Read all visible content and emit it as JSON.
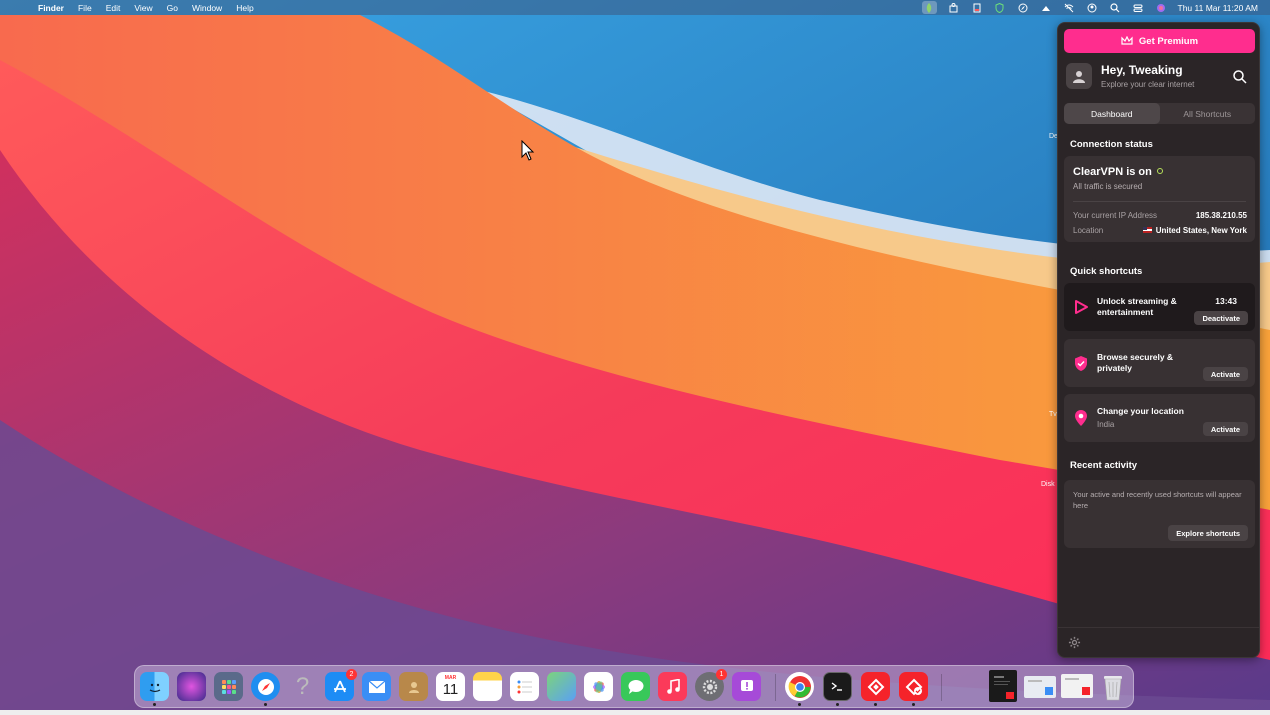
{
  "menubar": {
    "app_name": "Finder",
    "menus": [
      "File",
      "Edit",
      "View",
      "Go",
      "Window",
      "Help"
    ],
    "clock": "Thu 11 Mar  11:20 AM"
  },
  "desktop_labels": [
    "De",
    "Tv",
    "Disk"
  ],
  "vpn": {
    "premium_label": "Get Premium",
    "greeting": "Hey, Tweaking",
    "greeting_sub": "Explore your clear internet",
    "tabs": [
      "Dashboard",
      "All Shortcuts"
    ],
    "connection": {
      "section_title": "Connection status",
      "status": "ClearVPN is on",
      "status_sub": "All traffic is secured",
      "ip_label": "Your current IP Address",
      "ip_value": "185.38.210.55",
      "location_label": "Location",
      "location_value": "United States, New York"
    },
    "quick_shortcuts": {
      "section_title": "Quick shortcuts",
      "items": [
        {
          "title": "Unlock streaming & entertainment",
          "sub": "",
          "time": "13:43",
          "button": "Deactivate"
        },
        {
          "title": "Browse securely & privately",
          "sub": "",
          "time": "",
          "button": "Activate"
        },
        {
          "title": "Change your location",
          "sub": "India",
          "time": "",
          "button": "Activate"
        }
      ]
    },
    "recent": {
      "section_title": "Recent activity",
      "text": "Your active and recently used shortcuts will appear here",
      "button": "Explore shortcuts"
    }
  },
  "dock": {
    "app_store_badge": "2",
    "calendar_month": "MAR",
    "calendar_day": "11",
    "settings_badge": "1"
  },
  "colors": {
    "accent": "#ff2d8e",
    "panel_bg": "#2b2527",
    "card_bg": "#383133",
    "status_on": "#b7e05a"
  }
}
